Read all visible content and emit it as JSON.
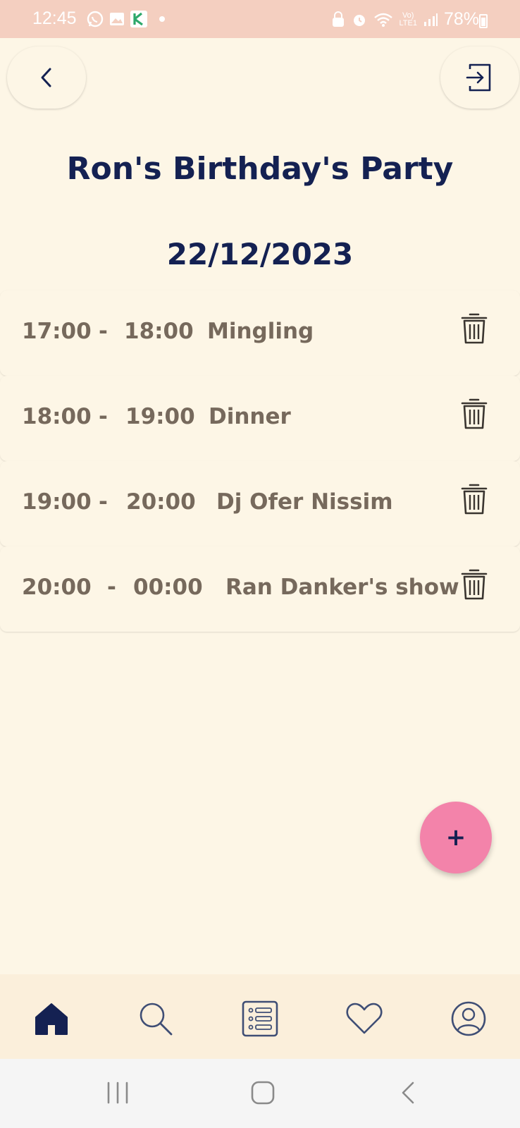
{
  "status_bar": {
    "time": "12:45",
    "battery": "78%",
    "network_top": "Vo)",
    "network_bottom": "LTE1"
  },
  "header": {
    "back_icon": "chevron-left-icon",
    "logout_icon": "logout-icon"
  },
  "event": {
    "title": "Ron's Birthday's Party",
    "date": "22/12/2023"
  },
  "schedule": [
    {
      "start": "17:00",
      "separator": "-",
      "end": "18:00",
      "name": "Mingling"
    },
    {
      "start": "18:00",
      "separator": "-",
      "end": "19:00",
      "name": "Dinner"
    },
    {
      "start": "19:00",
      "separator": "-",
      "end": "20:00",
      "name": "Dj Ofer Nissim"
    },
    {
      "start": "20:00",
      "separator": "-",
      "end": "00:00",
      "name": "Ran Danker's show"
    }
  ],
  "fab": {
    "label": "+"
  },
  "bottom_nav": {
    "items": [
      "home-icon",
      "search-icon",
      "list-icon",
      "heart-icon",
      "profile-icon"
    ],
    "active": "home-icon"
  },
  "colors": {
    "background": "#fdf6e6",
    "primary_text": "#142152",
    "row_text": "#76695c",
    "fab": "#f383aa",
    "status_bar": "#f4cfc0"
  }
}
